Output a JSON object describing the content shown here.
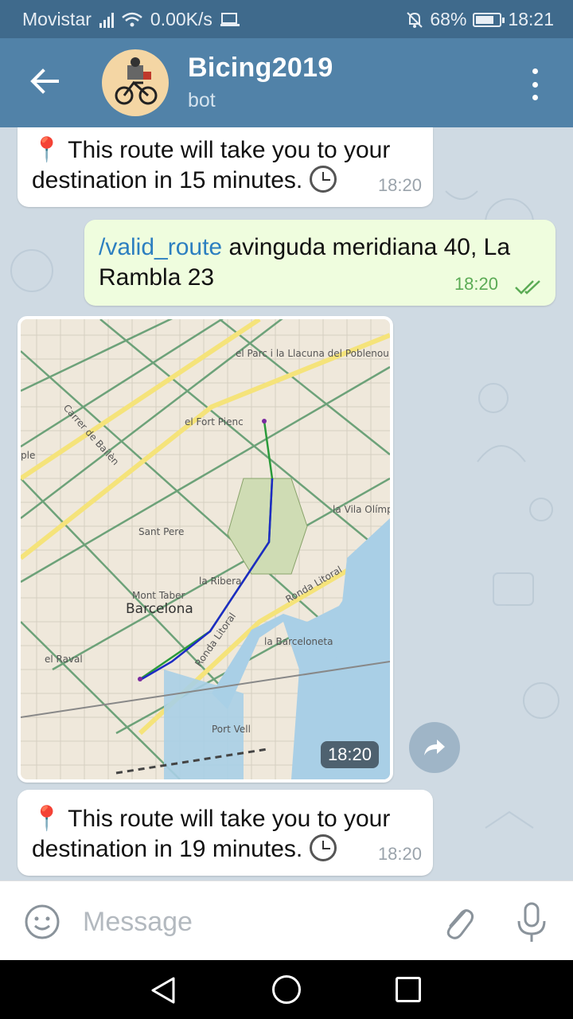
{
  "status_bar": {
    "carrier": "Movistar",
    "speed": "0.00K/s",
    "battery": "68%",
    "time": "18:21"
  },
  "header": {
    "title": "Bicing2019",
    "subtitle": "bot"
  },
  "messages": [
    {
      "pin": "📍",
      "text": "This route will take you to your destination in 15 minutes.",
      "time": "18:20"
    },
    {
      "command": "/valid_route",
      "text": " avinguda meridiana 40, La Rambla 23",
      "time": "18:20"
    },
    {
      "map_labels": {
        "parc": "el Parc i la Llacuna del Poblenou",
        "bailen": "Carrer de Bailèn",
        "fort_pienc": "el Fort Pienc",
        "ple": "ple",
        "vila_olimpica": "la Vila Olímp",
        "sant_pere": "Sant Pere",
        "ribera": "la Ribera",
        "mont_taber": "Mont Taber",
        "barcelona": "Barcelona",
        "ronda_litoral_1": "Ronda Litoral",
        "ronda_litoral_2": "Ronda Litoral",
        "barceloneta": "la Barceloneta",
        "raval": "el Raval",
        "port_vell": "Port Vell"
      },
      "time": "18:20"
    },
    {
      "pin": "📍",
      "text": "This route will take you to your destination in 19 minutes.",
      "time": "18:20"
    }
  ],
  "input": {
    "placeholder": "Message"
  },
  "colors": {
    "header": "#5182a8",
    "status_bar": "#3f6a8c",
    "outgoing_bubble": "#effdde",
    "link": "#2c7fc0",
    "route_blue": "#1d2bc4",
    "route_green": "#2a9a3a"
  }
}
